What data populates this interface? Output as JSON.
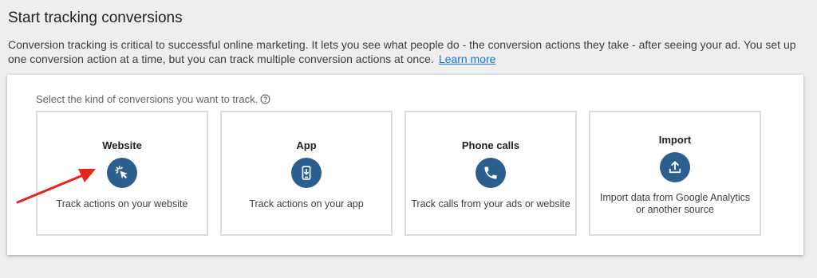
{
  "header": {
    "title": "Start tracking conversions",
    "description": "Conversion tracking is critical to successful online marketing. It lets you see what people do - the conversion actions they take - after seeing your ad. You set up one conversion action at a time, but you can track multiple conversion actions at once.",
    "learn_more": "Learn more"
  },
  "panel": {
    "prompt": "Select the kind of conversions you want to track.",
    "cards": [
      {
        "title": "Website",
        "icon": "cursor-click-icon",
        "description": "Track actions on your website"
      },
      {
        "title": "App",
        "icon": "mobile-download-icon",
        "description": "Track actions on your app"
      },
      {
        "title": "Phone calls",
        "icon": "phone-icon",
        "description": "Track calls from your ads or website"
      },
      {
        "title": "Import",
        "icon": "upload-icon",
        "description": "Import data from Google Analytics or another source"
      }
    ]
  },
  "colors": {
    "icon_background": "#2b5f8f",
    "link": "#1a73e8",
    "annotation_arrow": "#e8251c"
  }
}
